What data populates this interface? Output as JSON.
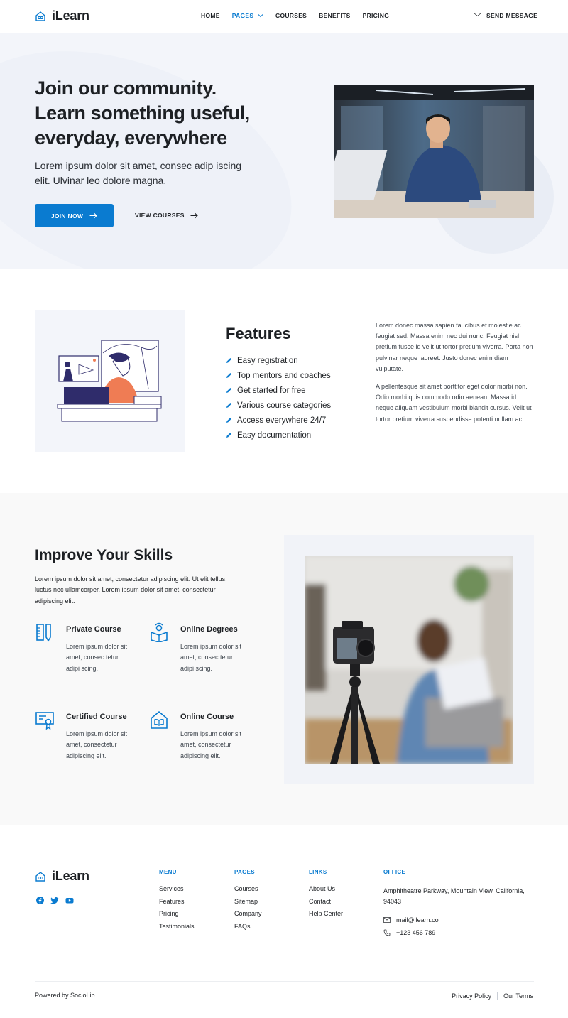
{
  "brand": {
    "name": "iLearn",
    "accent": "#0a7bd0"
  },
  "nav": {
    "links": [
      "HOME",
      "PAGES",
      "COURSES",
      "BENEFITS",
      "PRICING"
    ],
    "active": "PAGES",
    "send_message": "SEND MESSAGE"
  },
  "hero": {
    "title_lines": [
      "Join our community.",
      "Learn something useful,",
      "everyday, everywhere"
    ],
    "subtitle": "Lorem ipsum dolor sit amet, consec adip iscing elit. Ulvinar leo dolore magna.",
    "join_label": "JOIN NOW",
    "view_label": "VIEW COURSES"
  },
  "features": {
    "title": "Features",
    "items": [
      "Easy registration",
      "Top mentors and coaches",
      "Get started for free",
      "Various course categories",
      "Access everywhere 24/7",
      "Easy documentation"
    ],
    "paragraph1": "Lorem donec massa sapien faucibus et molestie ac feugiat sed. Massa enim nec dui nunc. Feugiat nisl pretium fusce id velit ut tortor pretium viverra. Porta non pulvinar neque laoreet. Justo donec enim diam vulputate.",
    "paragraph2": "A pellentesque sit amet porttitor eget dolor morbi non. Odio morbi quis commodo odio aenean. Massa id neque aliquam vestibulum morbi blandit cursus. Velit ut tortor pretium viverra suspendisse potenti nullam ac."
  },
  "skills": {
    "title": "Improve Your Skills",
    "subtitle": "Lorem ipsum dolor sit amet, consectetur adipiscing elit. Ut elit tellus, luctus nec ullamcorper. Lorem ipsum dolor sit amet, consectetur adipiscing elit.",
    "items": [
      {
        "title": "Private Course",
        "desc": "Lorem ipsum dolor sit amet, consec tetur adipi scing.",
        "icon": "ruler-pencil-icon"
      },
      {
        "title": "Online Degrees",
        "desc": "Lorem ipsum dolor sit amet, consec tetur adipi scing.",
        "icon": "reading-person-icon"
      },
      {
        "title": "Certified Course",
        "desc": "Lorem ipsum dolor sit amet, consectetur adipiscing elit.",
        "icon": "certificate-icon"
      },
      {
        "title": "Online Course",
        "desc": "Lorem ipsum dolor sit amet, consectetur adipiscing elit.",
        "icon": "house-book-icon"
      }
    ]
  },
  "footer": {
    "columns": [
      {
        "heading": "MENU",
        "links": [
          "Services",
          "Features",
          "Pricing",
          "Testimonials"
        ]
      },
      {
        "heading": "PAGES",
        "links": [
          "Courses",
          "Sitemap",
          "Company",
          "FAQs"
        ]
      },
      {
        "heading": "LINKS",
        "links": [
          "About Us",
          "Contact",
          "Help Center"
        ]
      }
    ],
    "office": {
      "heading": "OFFICE",
      "address": "Amphitheatre Parkway, Mountain View, California, 94043",
      "email": "mail@ilearn.co",
      "phone": "+123 456 789"
    },
    "powered": "Powered by SocioLib.",
    "privacy": "Privacy Policy",
    "terms": "Our Terms"
  }
}
